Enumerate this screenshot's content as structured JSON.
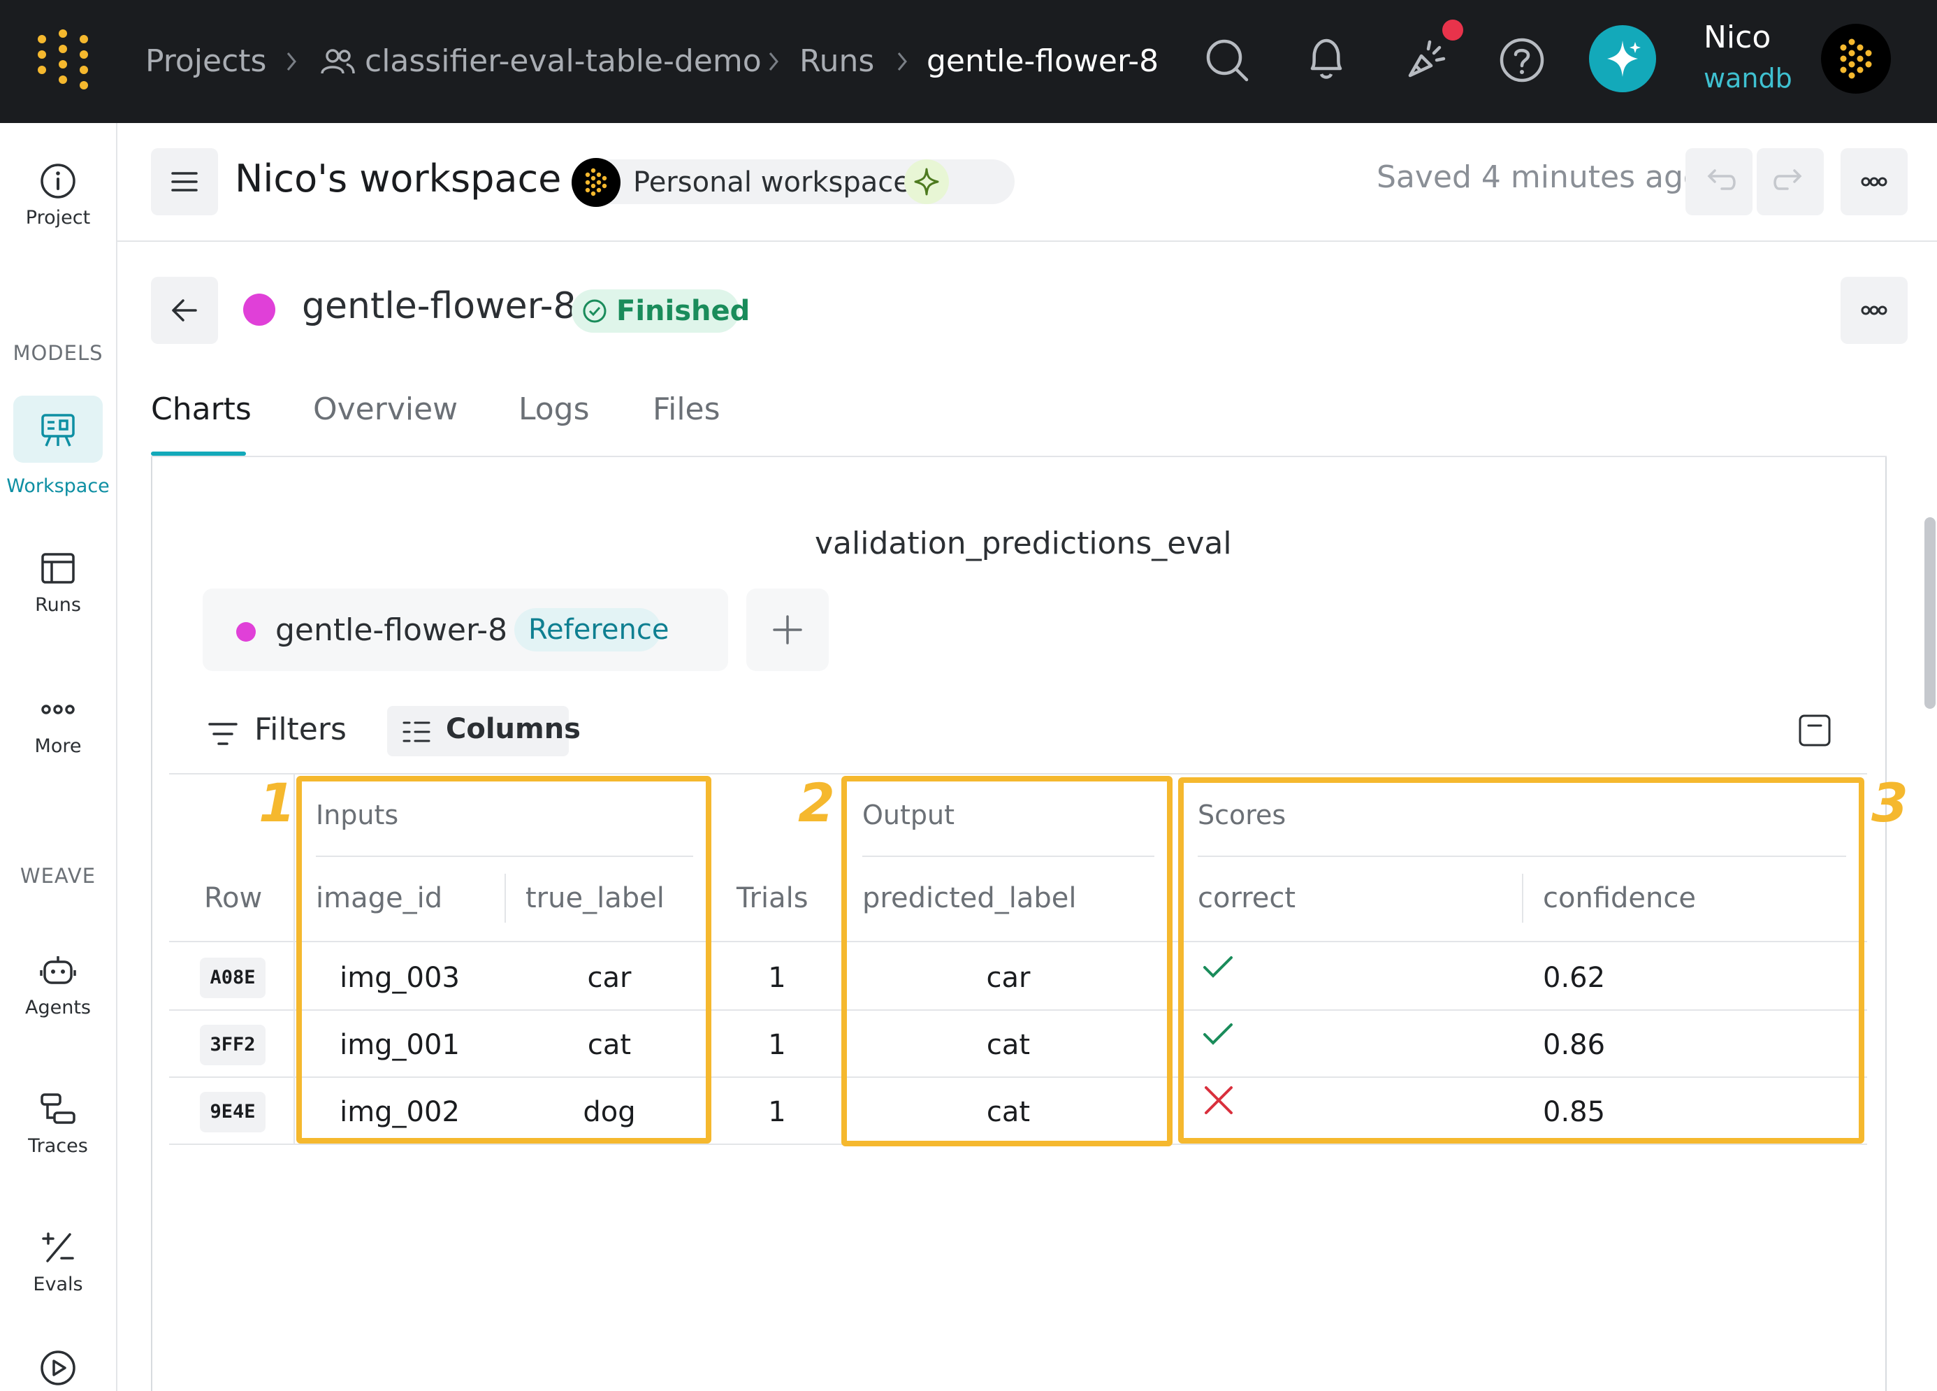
{
  "topbar": {
    "breadcrumb": {
      "projects": "Projects",
      "project": "classifier-eval-table-demo",
      "runs": "Runs",
      "current": "gentle-flower-8"
    },
    "user": {
      "name": "Nico",
      "org": "wandb"
    },
    "notification_dot_color": "#e8334b",
    "assistant_color": "#13a9ba"
  },
  "sidebar": {
    "project_label": "Project",
    "section_models": "MODELS",
    "section_weave": "WEAVE",
    "items": [
      {
        "label": "Workspace",
        "icon": "workspace-icon",
        "active": true
      },
      {
        "label": "Runs",
        "icon": "runs-icon"
      },
      {
        "label": "More",
        "icon": "more-dots-icon"
      },
      {
        "label": "Agents",
        "icon": "agents-icon"
      },
      {
        "label": "Traces",
        "icon": "traces-icon"
      },
      {
        "label": "Evals",
        "icon": "evals-icon"
      }
    ],
    "active_color": "#0e8fa3"
  },
  "workspace": {
    "title": "Nico's workspace",
    "badge": "Personal workspace",
    "saved_status": "Saved 4 minutes ago"
  },
  "run": {
    "name": "gentle-flower-8",
    "color": "#e040d8",
    "status": "Finished",
    "tabs": [
      "Charts",
      "Overview",
      "Logs",
      "Files"
    ],
    "active_tab": "Charts"
  },
  "eval_panel": {
    "title": "validation_predictions_eval",
    "compare_chip": {
      "run": "gentle-flower-8",
      "tag": "Reference"
    },
    "toolbar": {
      "filters": "Filters",
      "columns": "Columns"
    },
    "groups": {
      "inputs": "Inputs",
      "output": "Output",
      "scores": "Scores"
    },
    "columns": {
      "row": "Row",
      "image_id": "image_id",
      "true_label": "true_label",
      "trials": "Trials",
      "predicted_label": "predicted_label",
      "correct": "correct",
      "confidence": "confidence"
    },
    "rows": [
      {
        "row": "A08E",
        "image_id": "img_003",
        "true_label": "car",
        "trials": "1",
        "predicted_label": "car",
        "correct": true,
        "confidence": "0.62"
      },
      {
        "row": "3FF2",
        "image_id": "img_001",
        "true_label": "cat",
        "trials": "1",
        "predicted_label": "cat",
        "correct": true,
        "confidence": "0.86"
      },
      {
        "row": "9E4E",
        "image_id": "img_002",
        "true_label": "dog",
        "trials": "1",
        "predicted_label": "cat",
        "correct": false,
        "confidence": "0.85"
      }
    ],
    "annotations": [
      "1",
      "2",
      "3"
    ],
    "highlight_color": "#f5b82e",
    "check_color": "#1a8c5b",
    "cross_color": "#d9303d"
  }
}
